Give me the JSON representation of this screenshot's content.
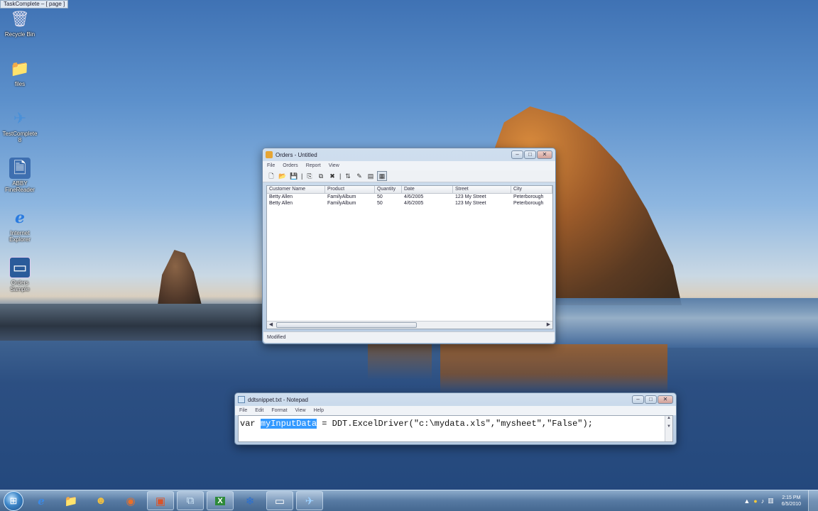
{
  "top_label": "TaskComplete – [ page ]",
  "desktop_icons": [
    {
      "label": "Recycle Bin",
      "glyph": "🗑"
    },
    {
      "label": "files",
      "glyph": "📁"
    },
    {
      "label": "TestComplete\n8",
      "glyph": "✈"
    },
    {
      "label": "ABBY\nFineReader",
      "glyph": "🗎"
    },
    {
      "label": "Internet\nExplorer",
      "glyph": "e"
    },
    {
      "label": "Orders\nSample",
      "glyph": "▭"
    }
  ],
  "orders_window": {
    "title": "Orders - Untitled",
    "menu": [
      "File",
      "Orders",
      "Report",
      "View"
    ],
    "toolbar_glyphs": [
      "🗋",
      "📂",
      "💾",
      "|",
      "⎘",
      "⧉",
      "✖",
      "|",
      "⇅",
      "✎",
      "▤",
      "▦"
    ],
    "columns": [
      "Customer Name",
      "Product",
      "Quantity",
      "Date",
      "Street",
      "City"
    ],
    "rows": [
      [
        "Betty Allen",
        "FamilyAlbum",
        "50",
        "4/6/2005",
        "123 My Street",
        "Peterborough"
      ],
      [
        "Betty Allen",
        "FamilyAlbum",
        "50",
        "4/6/2005",
        "123 My Street",
        "Peterborough"
      ]
    ],
    "status": "Modified"
  },
  "notepad_window": {
    "title": "ddtsnippet.txt - Notepad",
    "menu": [
      "File",
      "Edit",
      "Format",
      "View",
      "Help"
    ],
    "code_before": "var ",
    "code_selected": "myInputData",
    "code_after": " = DDT.ExcelDriver(\"c:\\mydata.xls\",\"mysheet\",\"False\");"
  },
  "taskbar": {
    "start_glyph": "⊞",
    "apps": [
      {
        "name": "internet-explorer",
        "glyph": "e",
        "open": false
      },
      {
        "name": "explorer",
        "glyph": "📁",
        "open": false
      },
      {
        "name": "messenger",
        "glyph": "☻",
        "open": false
      },
      {
        "name": "firefox",
        "glyph": "◉",
        "open": false
      },
      {
        "name": "powerpoint",
        "glyph": "▣",
        "open": true
      },
      {
        "name": "app",
        "glyph": "⧉",
        "open": true
      },
      {
        "name": "excel",
        "glyph": "X",
        "open": true
      },
      {
        "name": "snowflake",
        "glyph": "❄",
        "open": false
      },
      {
        "name": "orders",
        "glyph": "▭",
        "open": true
      },
      {
        "name": "testcomplete",
        "glyph": "✈",
        "open": true
      }
    ],
    "tray_glyphs": [
      "▲",
      "●",
      "♪",
      "▥"
    ],
    "clock_time": "2:15 PM",
    "clock_date": "6/5/2010"
  }
}
